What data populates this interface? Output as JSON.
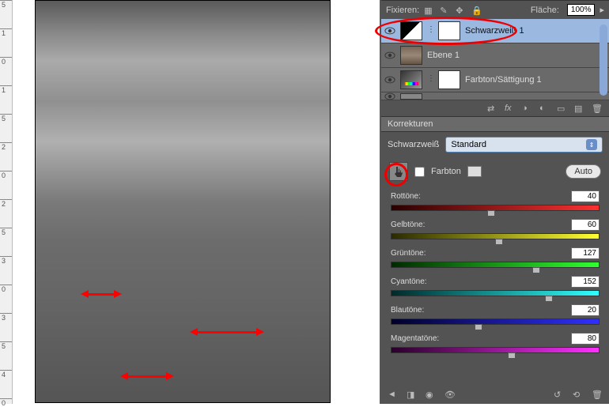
{
  "layers_panel": {
    "lock_label": "Fixieren:",
    "fill_label": "Fläche:",
    "fill_value": "100%",
    "items": [
      {
        "name": "Schwarzweiß 1",
        "type": "bw",
        "selected": true,
        "has_mask": true
      },
      {
        "name": "Ebene 1",
        "type": "img",
        "selected": false,
        "has_mask": false
      },
      {
        "name": "Farbton/Sättigung 1",
        "type": "hue",
        "selected": false,
        "has_mask": true
      }
    ]
  },
  "korrekturen": {
    "tab": "Korrekturen",
    "title": "Schwarzweiß",
    "preset": "Standard",
    "tint_label": "Farbton",
    "auto": "Auto",
    "sliders": [
      {
        "label": "Rottöne:",
        "value": 40,
        "gradient": "linear-gradient(90deg,#2a0000,#ff3030)",
        "pos": 48
      },
      {
        "label": "Gelbtöne:",
        "value": 60,
        "gradient": "linear-gradient(90deg,#2a2a00,#ffff30)",
        "pos": 52
      },
      {
        "label": "Grüntöne:",
        "value": 127,
        "gradient": "linear-gradient(90deg,#002a00,#30ff30)",
        "pos": 70
      },
      {
        "label": "Cyantöne:",
        "value": 152,
        "gradient": "linear-gradient(90deg,#002a2a,#30ffff)",
        "pos": 76
      },
      {
        "label": "Blautöne:",
        "value": 20,
        "gradient": "linear-gradient(90deg,#00002a,#3030ff)",
        "pos": 42
      },
      {
        "label": "Magentatöne:",
        "value": 80,
        "gradient": "linear-gradient(90deg,#2a002a,#ff30ff)",
        "pos": 58
      }
    ]
  },
  "ruler": [
    "5",
    "1",
    "0",
    "1",
    "5",
    "2",
    "0",
    "2",
    "5",
    "3",
    "0",
    "3",
    "5",
    "4",
    "0"
  ]
}
